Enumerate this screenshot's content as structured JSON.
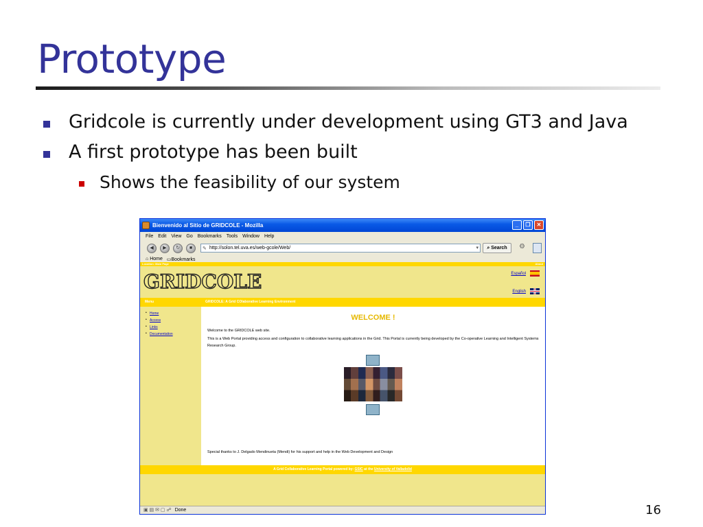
{
  "slide": {
    "title": "Prototype",
    "bullets": [
      "Gridcole is currently under development using GT3 and Java",
      "A first prototype has been built"
    ],
    "sub_bullet": "Shows the feasibility of our system",
    "page_number": "16"
  },
  "browser": {
    "window_title": "Bienvenido al Sitio de GRIDCOLE - Mozilla",
    "menu": [
      "File",
      "Edit",
      "View",
      "Go",
      "Bookmarks",
      "Tools",
      "Window",
      "Help"
    ],
    "url": "http://solon.tel.uva.es/web-gcole/Web/",
    "search_label": "Search",
    "bookmarks": [
      "Home",
      "Bookmarks"
    ],
    "status": "Done"
  },
  "website": {
    "location_label": "Location: Main Page",
    "location_right": "About",
    "logo": "GRIDCOLE",
    "lang_es": "Español",
    "lang_en": "English",
    "menu_label": "Menu",
    "site_description": "GRIDCOLE: A Grid COlaborative Learning Environment",
    "nav": [
      "Home",
      "Access",
      "Links",
      "Documentation"
    ],
    "welcome": "WELCOME !",
    "intro": "Welcome to the GRIDCOLE web site.",
    "description": "This is a Web Portal providing access and configuration to collaborative learning applications in the Grid. This Portal is currently being developed by the Co-operative Learning and Intelligent Systems Research Group.",
    "thanks": "Special thanks to J. Delgado Mendinueta (Mendi) for his support and help in the Web Development and Design",
    "footer_prefix": "A Grid Collaborative Learning Portal powered by:",
    "footer_org": "GSIC",
    "footer_mid": "at the",
    "footer_univ": "University of Valladolid"
  },
  "colors": {
    "title": "#333399",
    "bullet_l1": "#333399",
    "bullet_l2": "#cc0000",
    "site_yellow": "#ffd700",
    "site_khaki": "#f0e68c"
  }
}
